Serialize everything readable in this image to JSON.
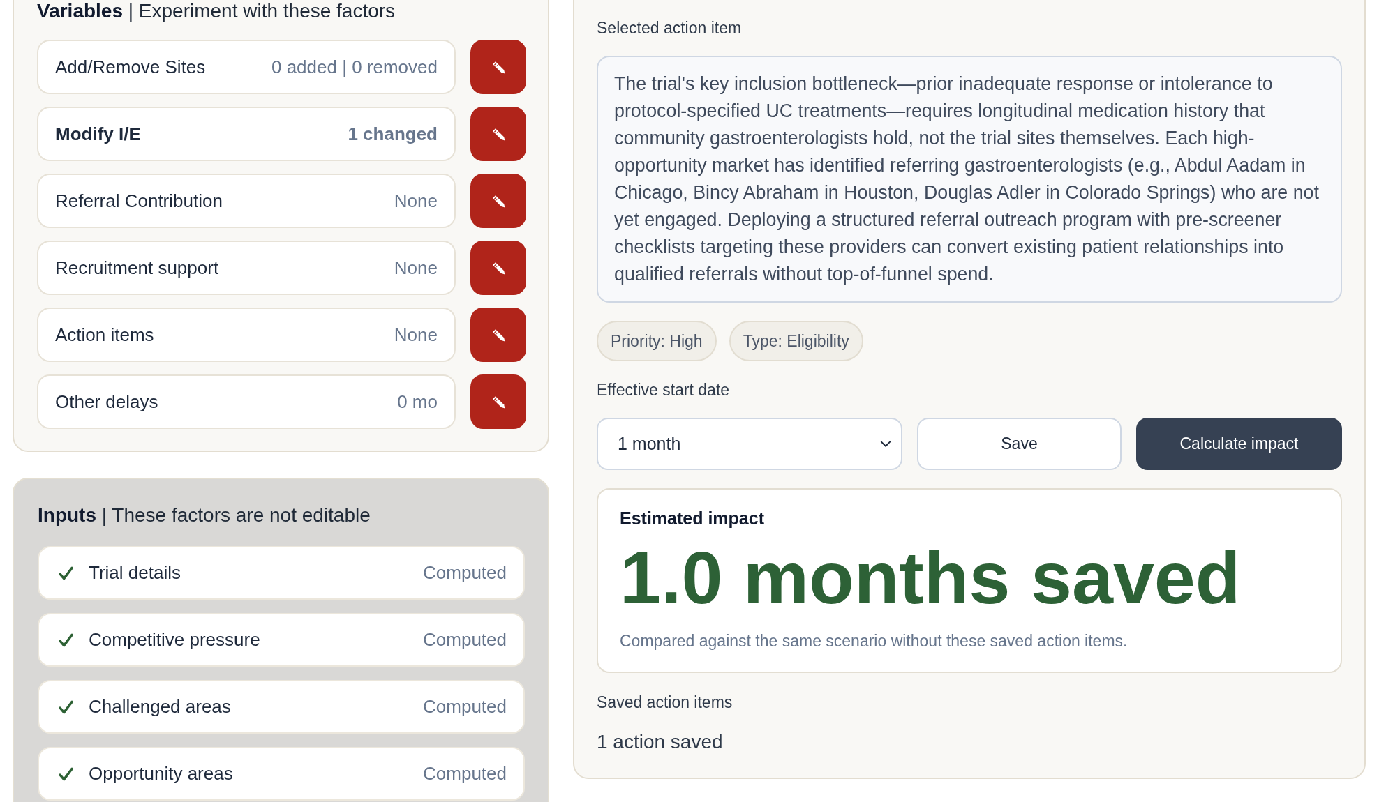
{
  "variables": {
    "title": "**Variables** | Experiment with these factors",
    "rows": [
      {
        "label": "Add/Remove Sites",
        "value": "0 added | 0 removed",
        "modified": false
      },
      {
        "label": "Modify I/E",
        "value": "1 changed",
        "modified": true
      },
      {
        "label": "Referral Contribution",
        "value": "None",
        "modified": false
      },
      {
        "label": "Recruitment support",
        "value": "None",
        "modified": false
      },
      {
        "label": "Action items",
        "value": "None",
        "modified": false
      },
      {
        "label": "Other delays",
        "value": "0 mo",
        "modified": false
      }
    ]
  },
  "inputs": {
    "title": "**Inputs** | These factors are not editable",
    "rows": [
      {
        "label": "Trial details",
        "value": "Computed",
        "checked": true
      },
      {
        "label": "Competitive pressure",
        "value": "Computed",
        "checked": true
      },
      {
        "label": "Challenged areas",
        "value": "Computed",
        "checked": true
      },
      {
        "label": "Opportunity areas",
        "value": "Computed",
        "checked": true
      }
    ]
  },
  "action_item": {
    "label": "Selected action item",
    "description": "The trial's key inclusion bottleneck—prior inadequate response or intolerance to protocol-specified UC treatments—requires longitudinal medication history that community gastroenterologists hold, not the trial sites themselves. Each high-opportunity market has identified referring gastroenterologists (e.g., Abdul Aadam in Chicago, Bincy Abraham in Houston, Douglas Adler in Colorado Springs) who are not yet engaged. Deploying a structured referral outreach program with pre-screener checklists targeting these providers can convert existing patient relationships into qualified referrals without top-of-funnel spend.",
    "tags": [
      "Priority: High",
      "Type: Eligibility"
    ],
    "start_date_label": "Effective start date",
    "start_date": "1 month",
    "buttons": [
      {
        "label": "Save",
        "kind": "secondary"
      },
      {
        "label": "Calculate impact",
        "kind": "primary"
      }
    ]
  },
  "impact": {
    "title": "Estimated impact",
    "value": "1.0 months saved",
    "note": "Compared against the same scenario without these saved action items."
  },
  "saved": {
    "label": "Saved action items",
    "count": "1 action saved"
  }
}
